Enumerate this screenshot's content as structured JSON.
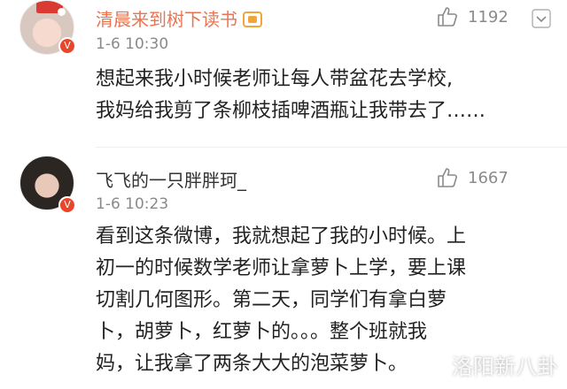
{
  "comments": [
    {
      "username": "清晨来到树下读书",
      "time": "1-6 10:30",
      "likes": "1192",
      "text_lines": [
        "想起来我小时候老师让每人带盆花去学校,",
        "我妈给我剪了条柳枝插啤酒瓶让我带去了……"
      ],
      "badge": "V"
    },
    {
      "username": "飞飞的一只胖胖珂_",
      "time": "1-6 10:23",
      "likes": "1667",
      "text_lines": [
        "看到这条微博，我就想起了我的小时候。上",
        "初一的时候数学老师让拿萝卜上学，要上课",
        "切割几何图形。第二天，同学们有拿白萝",
        "卜，胡萝卜，红萝卜的。。。整个班就我",
        "妈，让我拿了两条大大的泡菜萝卜。"
      ],
      "badge": "V"
    }
  ],
  "watermark": "洛阳新八卦"
}
